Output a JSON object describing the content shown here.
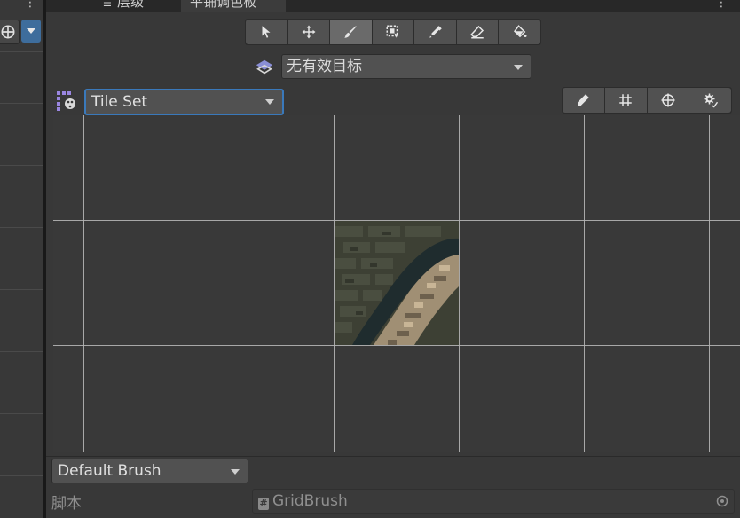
{
  "tabs": {
    "hierarchy": "层级",
    "palette": "平铺调色板"
  },
  "toolbar": {
    "tools": [
      "select-tool",
      "move-tool",
      "paint-tool",
      "box-fill-tool",
      "picker-tool",
      "erase-tool",
      "fill-tool"
    ],
    "active": "paint-tool"
  },
  "target": {
    "label": "无有效目标"
  },
  "tileset": {
    "label": "Tile Set"
  },
  "view_tools": [
    "edit-icon",
    "grid-icon",
    "gizmo-icon",
    "settings-icon"
  ],
  "brush": {
    "label": "Default Brush"
  },
  "script": {
    "label": "脚本",
    "value": "GridBrush",
    "hash": "#"
  },
  "colors": {
    "accent": "#3a79bb",
    "panel": "#383838",
    "button": "#515151"
  }
}
